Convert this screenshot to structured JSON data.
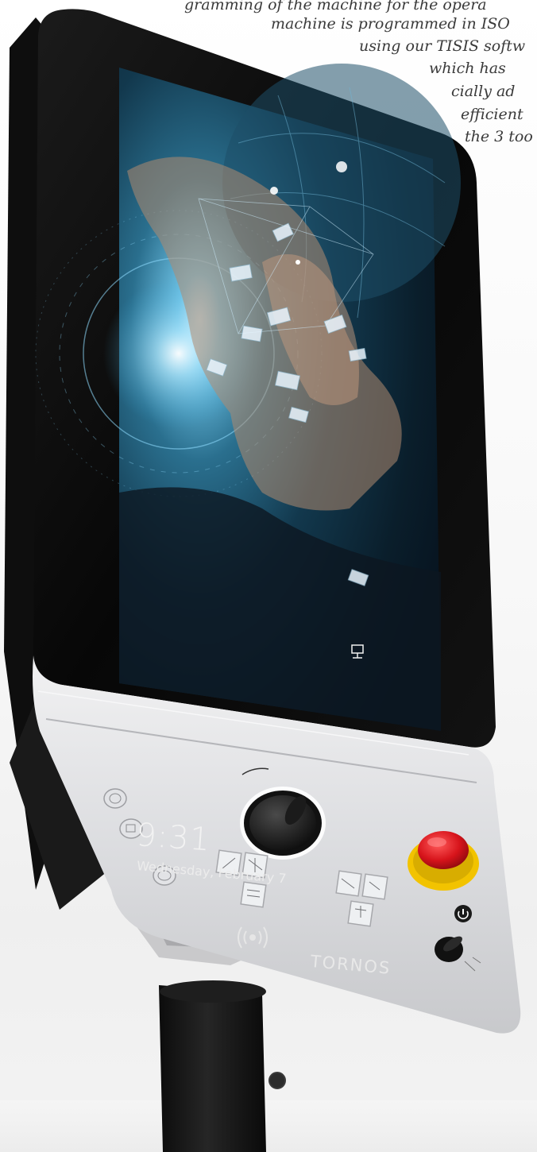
{
  "caption_lines": [
    "gramming of the machine for the opera",
    "machine is programmed in ISO",
    "using our TISIS softw",
    "which has",
    "cially ad",
    "efficient",
    "the 3 too"
  ],
  "lock_screen": {
    "time": "9:31",
    "date": "Wednesday, February 7"
  },
  "brand": "TORNOS",
  "icons": [
    "nfc-reader-icon",
    "network-icon",
    "emergency-stop-button",
    "power-icon",
    "handwheel-knob",
    "selector-switch-knob"
  ],
  "colors": {
    "screen_bezel": "#0b0b0b",
    "control_panel": "#d9dadc",
    "emergency_stop_red": "#d7141b",
    "emergency_stop_base": "#f2c300",
    "stand": "#171717"
  }
}
